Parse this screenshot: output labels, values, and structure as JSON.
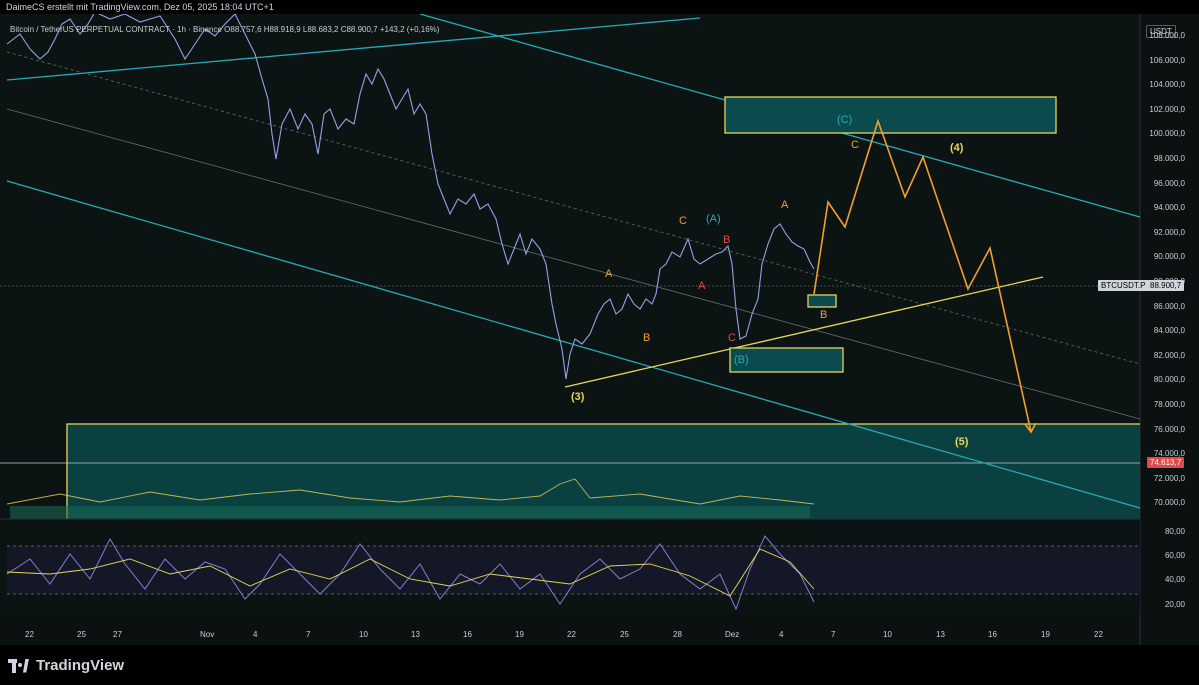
{
  "header": {
    "caption": "DaimeCS erstellt mit TradingView.com, Dez 05, 2025 18:04 UTC+1"
  },
  "legend": {
    "text": "Bitcoin / TetherUS PERPETUAL CONTRACT · 1h · Binance  O88.757,6  H88.918,9  L88.683,2  C88.900,7  +143,2 (+0,16%)"
  },
  "currency": "USDT",
  "price_axis": [
    "108.000,0",
    "106.000,0",
    "104.000,0",
    "102.000,0",
    "100.000,0",
    "98.000,0",
    "96.000,0",
    "94.000,0",
    "92.000,0",
    "90.000,0",
    "88.000,0",
    "86.000,0",
    "84.000,0",
    "82.000,0",
    "80.000,0",
    "78.000,0",
    "76.000,0",
    "74.000,0",
    "72.000,0",
    "70.000,0"
  ],
  "rsi_axis": [
    "80,00",
    "60,00",
    "40,00",
    "20,00"
  ],
  "time_axis": [
    "22",
    "25",
    "27",
    "Nov",
    "4",
    "7",
    "10",
    "13",
    "16",
    "19",
    "22",
    "25",
    "28",
    "Dez",
    "4",
    "7",
    "10",
    "13",
    "16",
    "19",
    "22"
  ],
  "tags": {
    "symbol": "BTCUSDT.P",
    "last_price": "88.900,7",
    "level": "74.613,7"
  },
  "colors": {
    "cyan": "#26a9b8",
    "yellow": "#e8d55a",
    "orange": "#f0a030",
    "red": "#e04a4a",
    "candles": "#8fa3e6",
    "zone": "#0b4b4e"
  },
  "wave_labels": {
    "w3": "(3)",
    "w4": "(4)",
    "w5": "(5)",
    "wA": "(A)",
    "wB": "(B)",
    "wC": "(C)",
    "a1": "A",
    "b1": "B",
    "c1": "C",
    "a2": "A",
    "b2": "B",
    "c2": "C",
    "a3": "A",
    "b3": "B",
    "c3": "C"
  },
  "branding": {
    "name": "TradingView"
  }
}
